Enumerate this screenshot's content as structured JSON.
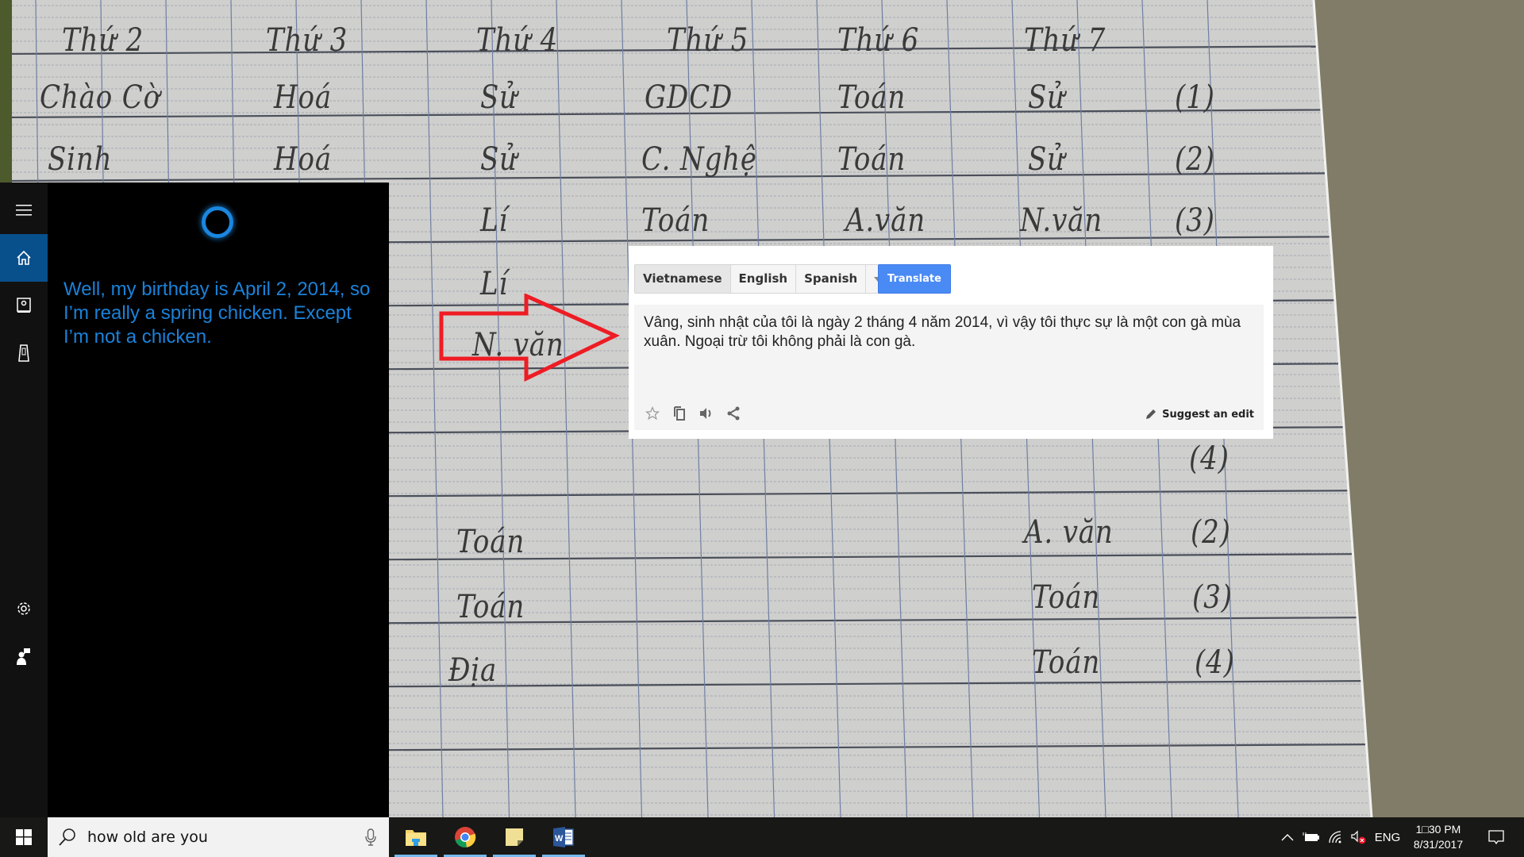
{
  "photo": {
    "description": "Photo of handwritten class timetable on grid paper",
    "headers": [
      "Thứ 2",
      "Thứ 3",
      "Thứ 4",
      "Thứ 5",
      "Thứ 6",
      "Thứ 7"
    ],
    "rows": [
      [
        "Chào Cờ",
        "Hoá",
        "Sử",
        "GDCD",
        "Toán",
        "Sử",
        "(1)"
      ],
      [
        "Sinh",
        "Hoá",
        "Sử",
        "C. Nghệ",
        "Toán",
        "Sử",
        "(2)"
      ],
      [
        "",
        "",
        "Lí",
        "Toán",
        "A.văn",
        "N.văn",
        "(3)"
      ],
      [
        "",
        "",
        "Lí",
        "",
        "",
        "",
        ""
      ],
      [
        "",
        "",
        "N. văn",
        "",
        "",
        "",
        "(4)"
      ],
      [
        "",
        "Toán",
        "",
        "",
        "",
        "A. văn",
        "(2)"
      ],
      [
        "",
        "Toán",
        "",
        "",
        "",
        "Toán",
        "(3)"
      ],
      [
        "",
        "Địa",
        "",
        "",
        "",
        "Toán",
        "(4)"
      ]
    ]
  },
  "cortana": {
    "nav": [
      {
        "name": "menu",
        "icon": "hamburger-icon"
      },
      {
        "name": "home",
        "icon": "home-icon",
        "active": true
      },
      {
        "name": "notebook",
        "icon": "notebook-icon"
      },
      {
        "name": "devices",
        "icon": "phone-icon"
      },
      {
        "name": "settings",
        "icon": "gear-icon"
      },
      {
        "name": "feedback",
        "icon": "feedback-icon"
      }
    ],
    "reply": "Well, my birthday is April 2, 2014, so I’m really a spring chicken. Except I’m not a chicken.",
    "accent": "#1a82d9"
  },
  "translate": {
    "languages": [
      "Vietnamese",
      "English",
      "Spanish"
    ],
    "selected_language": "Vietnamese",
    "translate_button": "Translate",
    "result": "Vâng, sinh nhật của tôi là ngày 2 tháng 4 năm 2014, vì vậy tôi thực sự là một con gà mùa xuân. Ngoại trừ tôi không phải là con gà.",
    "tools": [
      "star-icon",
      "copy-icon",
      "speaker-icon",
      "share-icon"
    ],
    "suggest_edit": "Suggest an edit",
    "button_color": "#4a8af4"
  },
  "taskbar": {
    "search_query": "how old are you",
    "apps": [
      "File Explorer",
      "Google Chrome",
      "Sticky Notes",
      "Microsoft Word"
    ],
    "language": "ENG",
    "time": "1□30 PM",
    "date": "8/31/2017"
  }
}
